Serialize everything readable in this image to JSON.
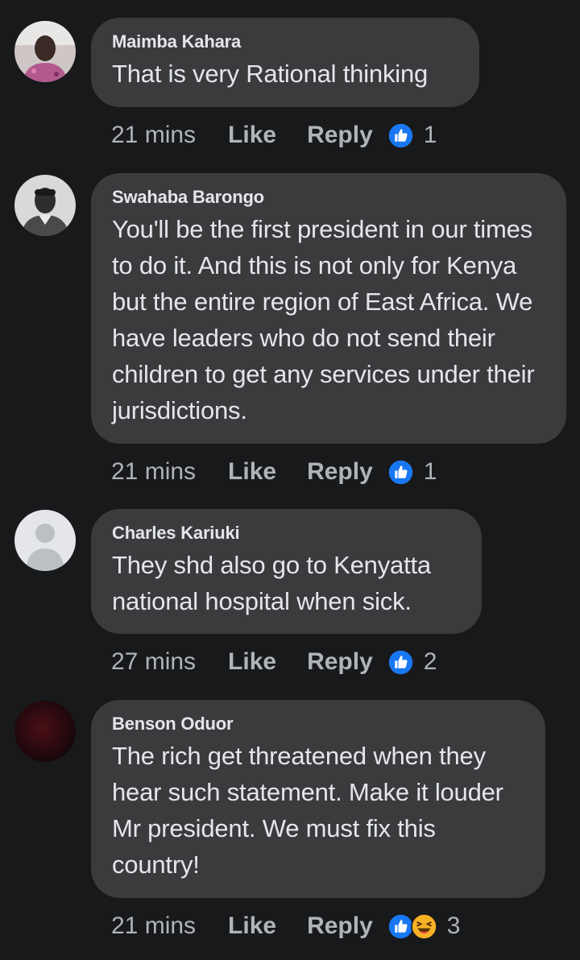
{
  "comments": [
    {
      "author": "Maimba Kahara",
      "text": "That is very Rational thinking",
      "time": "21 mins",
      "like_label": "Like",
      "reply_label": "Reply",
      "reactions": [
        "like-icon"
      ],
      "reaction_count": "1"
    },
    {
      "author": "Swahaba Barongo",
      "text": "You'll be the first president in our times to do it. And this is not only for Kenya but the entire region of East Africa. We have leaders who do not send their children to get any services under their jurisdictions.",
      "time": "21 mins",
      "like_label": "Like",
      "reply_label": "Reply",
      "reactions": [
        "like-icon"
      ],
      "reaction_count": "1"
    },
    {
      "author": "Charles Kariuki",
      "text": "They shd also go to Kenyatta national hospital when sick.",
      "time": "27 mins",
      "like_label": "Like",
      "reply_label": "Reply",
      "reactions": [
        "like-icon"
      ],
      "reaction_count": "2"
    },
    {
      "author": "Benson Oduor",
      "text": "The rich get threatened when they hear such statement. Make it louder Mr president. We must fix this country!",
      "time": "21 mins",
      "like_label": "Like",
      "reply_label": "Reply",
      "reactions": [
        "like-icon",
        "haha-icon"
      ],
      "reaction_count": "3"
    }
  ],
  "colors": {
    "background": "#18191a",
    "bubble": "#3a3b3c",
    "text": "#e4e6eb",
    "secondary": "#b0b3b8",
    "like_blue": "#1877f2",
    "haha_yellow": "#f7b125"
  }
}
